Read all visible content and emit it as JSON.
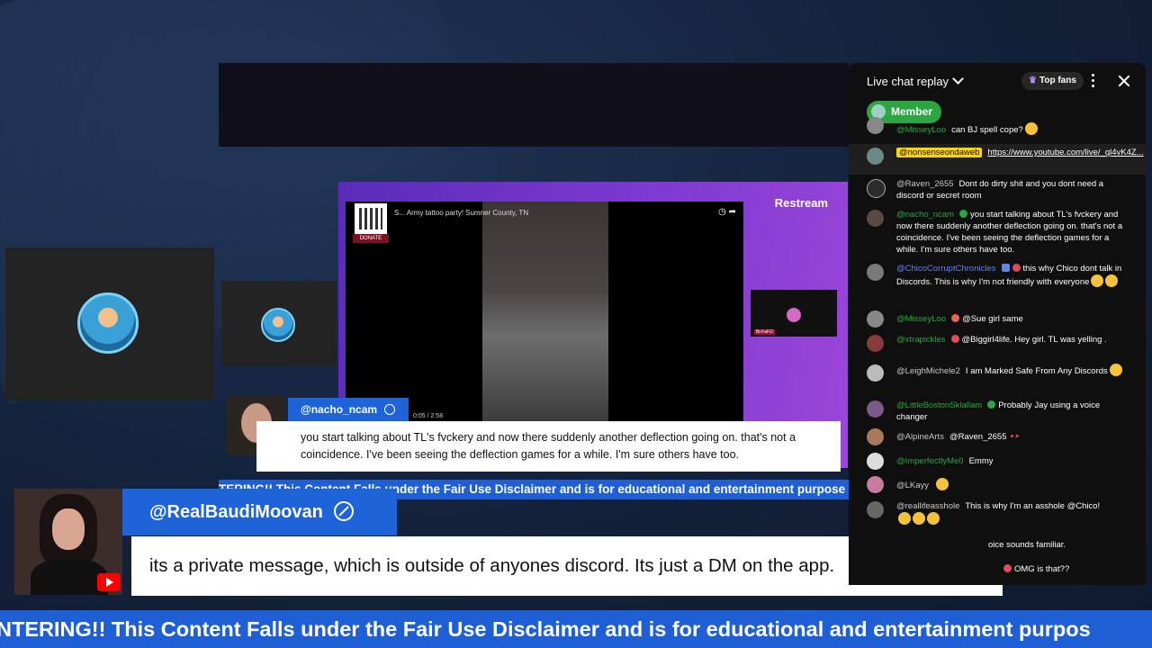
{
  "restream": {
    "logo": "Restream"
  },
  "video": {
    "title": "S... Army tattoo party! Sumner County, TN",
    "donate": "DONATE",
    "time": "0:05 / 2:58",
    "mini_cam_label": "Bi-FaFO"
  },
  "banner_small": {
    "username": "@nacho_ncam",
    "message": "you start talking about TL's fvckery and now there suddenly another deflection going on. that's not a coincidence. I've been seeing the deflection games for a while. I'm sure others have too."
  },
  "ticker_mid": "TERING!! This Content Falls under the Fair Use Disclaimer and is for educational and entertainment purpose",
  "banner_main": {
    "username": "@RealBaudiMoovan",
    "message": "its a private message, which is outside of anyones discord. Its just a DM on the app."
  },
  "ticker_bottom": "NTERING!! This Content Falls under the Fair Use Disclaimer and is for educational and entertainment purpos",
  "chat": {
    "title": "Live chat replay",
    "top_fans": "Top fans",
    "member_label": "Member",
    "messages": [
      {
        "author": "@MisseyLoo",
        "text": "can BJ spell cope?"
      },
      {
        "author": "@nonsenseondaweb",
        "text": "https://www.youtube.com/live/_ql4vK4Z..."
      },
      {
        "author": "@Raven_2655",
        "text": "Dont do dirty shit and you dont need a discord or secret room"
      },
      {
        "author": "@nacho_ncam",
        "text": "you start talking about TL's fvckery and now there suddenly another deflection going on. that's not a coincidence. I've been seeing the deflection games for a while. I'm sure others have too."
      },
      {
        "author": "@ChicoCorruptChronicles",
        "text": "this why Chico dont talk in Discords. This is why I'm not friendly with everyone"
      },
      {
        "author": "@MisseyLoo",
        "text": "@Sue girl same"
      },
      {
        "author": "@xtrapickles",
        "text": "@Biggirl4life. Hey girl. TL was yelling ."
      },
      {
        "author": "@LeighMichele2",
        "text": "I am Marked Safe From Any Discords"
      },
      {
        "author": "@LittleBostonSklallam",
        "text": "Probably Jay using a voice changer"
      },
      {
        "author": "@AlpineArts",
        "text": "@Raven_2655"
      },
      {
        "author": "@ImperfectlyMe0",
        "text": "Emmy"
      },
      {
        "author": "@LKayy",
        "text": ""
      },
      {
        "author": "@reallifeasshole",
        "text": "This is why I'm an asshole @Chico!"
      },
      {
        "author": "",
        "text": "oice sounds familiar."
      },
      {
        "author": "",
        "text": "OMG is that??"
      }
    ]
  },
  "colors": {
    "accent_blue": "#1e63d8",
    "restream_purple": "#7b3ad1",
    "member_green": "#2ba640",
    "highlight_yellow": "#ffd600"
  }
}
